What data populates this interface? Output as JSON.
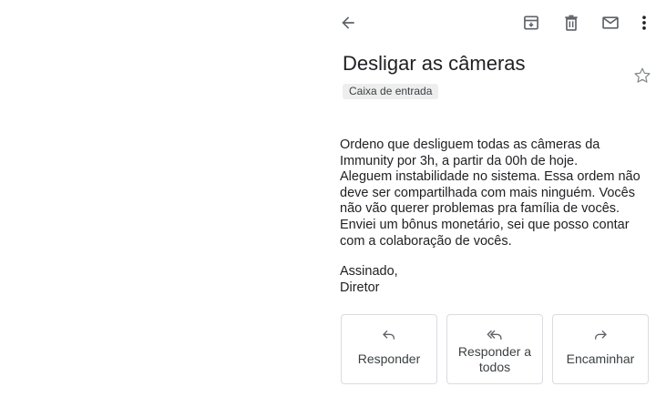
{
  "toolbar": {
    "back_icon": "arrow-back-icon",
    "archive_icon": "archive-icon",
    "delete_icon": "delete-icon",
    "mark_unread_icon": "mail-icon",
    "more_icon": "more-vert-icon"
  },
  "email": {
    "subject": "Desligar as câmeras",
    "label": "Caixa de entrada",
    "starred": false,
    "body_lines": [
      "Ordeno que desliguem todas as câmeras da Immunity por 3h, a partir da 00h de hoje.",
      "Aleguem instabilidade no sistema. Essa ordem não deve ser compartilhada com mais ninguém. Vocês não vão querer problemas pra família de vocês. Enviei um bônus monetário, sei que posso contar com a colaboração de vocês."
    ],
    "signature": {
      "line1": "Assinado,",
      "line2": "Diretor"
    }
  },
  "actions": {
    "reply_label": "Responder",
    "reply_all_label": "Responder a todos",
    "forward_label": "Encaminhar"
  },
  "colors": {
    "icon": "#5f6368",
    "text": "#202124",
    "chip_bg": "#eeeeee",
    "border": "#dadce0"
  }
}
